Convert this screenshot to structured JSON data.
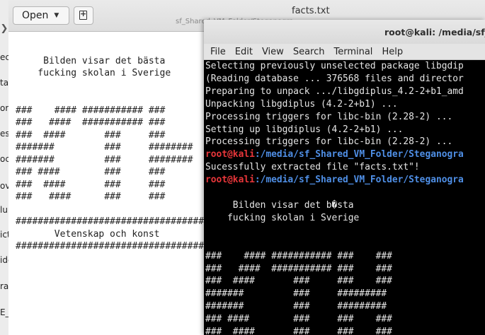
{
  "left_strip": {
    "fragments": [
      "ec",
      "ta",
      "or",
      "es",
      "oc",
      "ov",
      "lu",
      "ict",
      "ide",
      "ra",
      "E_"
    ]
  },
  "editor": {
    "open_label": "Open",
    "title": "facts.txt",
    "subtitle": "sf_Shared_VM_Folder/Steganogra...",
    "lines": [
      "",
      "     Bilden visar det bästa",
      "    fucking skolan i Sverige",
      "",
      "",
      "###    #### ########### ###",
      "###   ####  ########### ###",
      "###  ####       ###     ###",
      "#######         ###     ########",
      "#######         ###     ########",
      "### ####        ###     ###",
      "###  ####       ###     ###",
      "###   ####      ###     ###",
      "",
      "###################################",
      "       Vetenskap och konst",
      "###################################"
    ]
  },
  "terminal": {
    "title": "root@kali: /media/sf_S",
    "menu": [
      "File",
      "Edit",
      "View",
      "Search",
      "Terminal",
      "Help"
    ],
    "output_top": [
      "Selecting previously unselected package libgdip",
      "(Reading database ... 376568 files and director",
      "Preparing to unpack .../libgdiplus_4.2-2+b1_amd",
      "Unpacking libgdiplus (4.2-2+b1) ...",
      "Processing triggers for libc-bin (2.28-2) ...",
      "Setting up libgdiplus (4.2-2+b1) ...",
      "Processing triggers for libc-bin (2.28-2) ..."
    ],
    "prompt_user": "root@kali",
    "prompt_path": ":/media/sf_Shared_VM_Folder/Steganogra",
    "extracted_msg": "Sucessfully extracted file \"facts.txt\"!",
    "output_bottom": [
      "",
      "     Bilden visar det b�sta",
      "    fucking skolan i Sverige",
      "",
      "",
      "###    #### ########### ###    ###",
      "###   ####  ########### ###    ###",
      "###  ####       ###     ###    ###",
      "#######         ###     #########",
      "#######         ###     #########",
      "### ####        ###     ###    ###",
      "###  ####       ###     ###    ###",
      "###   ####      ###     ###    ###"
    ]
  }
}
